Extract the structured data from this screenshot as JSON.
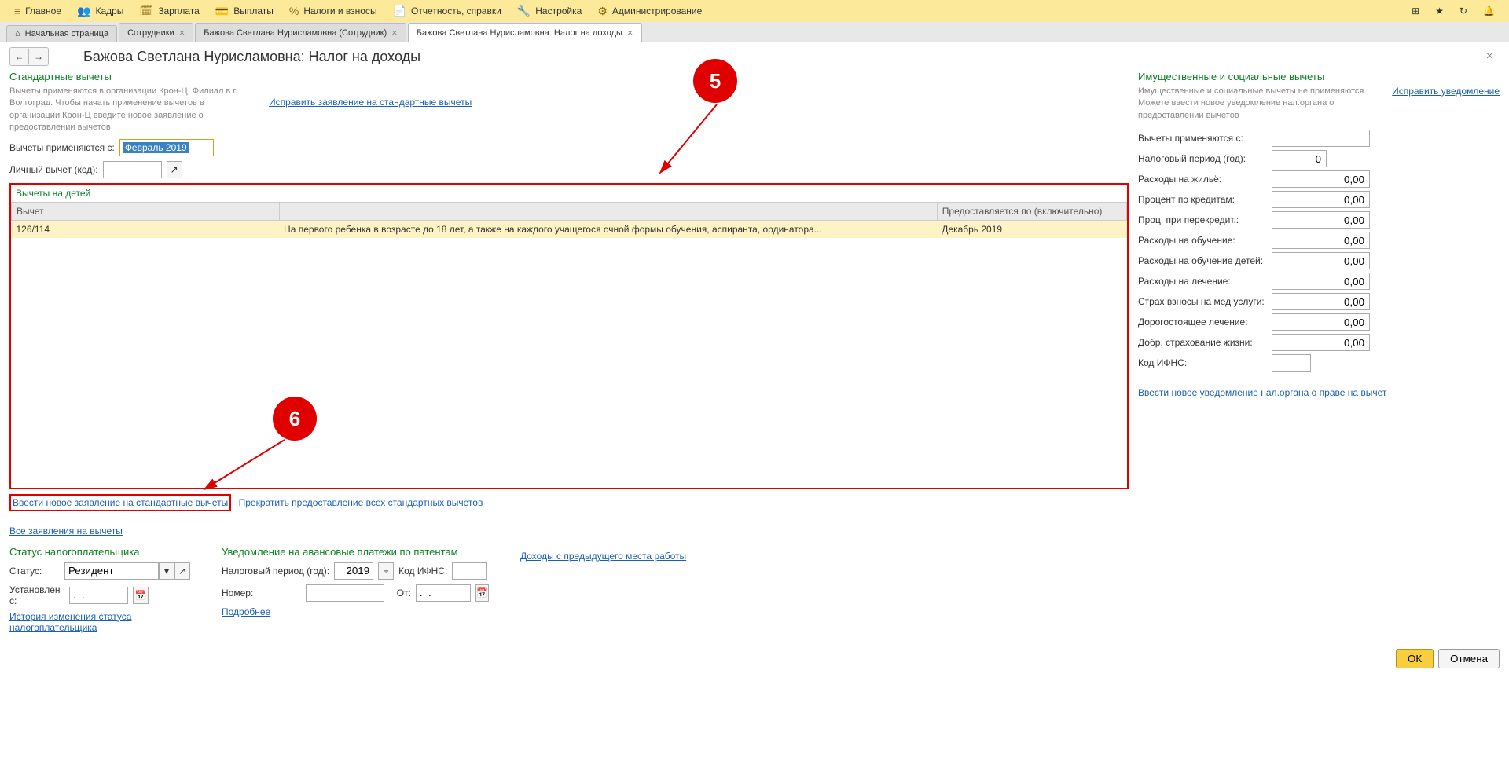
{
  "topbar": {
    "items": [
      {
        "label": "Главное"
      },
      {
        "label": "Кадры"
      },
      {
        "label": "Зарплата"
      },
      {
        "label": "Выплаты"
      },
      {
        "label": "Налоги и взносы"
      },
      {
        "label": "Отчетность, справки"
      },
      {
        "label": "Настройка"
      },
      {
        "label": "Администрирование"
      }
    ]
  },
  "tabs": [
    {
      "label": "Начальная страница",
      "closable": false,
      "home": true
    },
    {
      "label": "Сотрудники",
      "closable": true
    },
    {
      "label": "Бажова Светлана Нурисламовна (Сотрудник)",
      "closable": true
    },
    {
      "label": "Бажова Светлана Нурисламовна: Налог на доходы",
      "closable": true,
      "active": true
    }
  ],
  "pageTitle": "Бажова Светлана Нурисламовна: Налог на доходы",
  "std": {
    "title": "Стандартные вычеты",
    "hint": "Вычеты применяются в организации Крон-Ц, Филиал в г. Волгоград. Чтобы начать применение вычетов в организации Крон-Ц введите новое заявление о предоставлении вычетов",
    "fixLink": "Исправить заявление на стандартные вычеты",
    "appliedFromLabel": "Вычеты применяются с:",
    "appliedFromValue": "Февраль 2019",
    "personalCodeLabel": "Личный вычет (код):",
    "childrenTitle": "Вычеты на детей",
    "table": {
      "col1": "Вычет",
      "col2": "Предоставляется по (включительно)",
      "code": "126/114",
      "desc": "На первого ребенка в возрасте до 18 лет, а также на каждого учащегося очной формы обучения, аспиранта, ординатора...",
      "until": "Декабрь 2019"
    },
    "newStmtLink": "Ввести новое заявление на стандартные вычеты",
    "stopLink": "Прекратить предоставление всех стандартных вычетов",
    "allLink": "Все заявления на вычеты"
  },
  "prop": {
    "title": "Имущественные и социальные вычеты",
    "hint": "Имущественные и социальные вычеты не применяются. Можете ввести новое уведомление нал.органа о предоставлении вычетов",
    "fixLink": "Исправить уведомление",
    "appliedFromLabel": "Вычеты применяются с:",
    "taxPeriodLabel": "Налоговый период (год):",
    "taxPeriodValue": "0",
    "rows": [
      {
        "label": "Расходы на жильё:",
        "value": "0,00"
      },
      {
        "label": "Процент по кредитам:",
        "value": "0,00"
      },
      {
        "label": "Проц. при перекредит.:",
        "value": "0,00"
      },
      {
        "label": "Расходы на обучение:",
        "value": "0,00"
      },
      {
        "label": "Расходы на обучение детей:",
        "value": "0,00"
      },
      {
        "label": "Расходы на лечение:",
        "value": "0,00"
      },
      {
        "label": "Страх взносы на мед услуги:",
        "value": "0,00"
      },
      {
        "label": "Дорогостоящее лечение:",
        "value": "0,00"
      },
      {
        "label": "Добр. страхование жизни:",
        "value": "0,00"
      }
    ],
    "ifnsLabel": "Код ИФНС:",
    "newNoticeLink": "Ввести новое уведомление нал.органа о праве на вычет"
  },
  "status": {
    "title": "Статус налогоплательщика",
    "statusLabel": "Статус:",
    "statusValue": "Резидент",
    "setFromLabel": "Установлен с:",
    "setFromValue": ".  .",
    "historyLink": "История изменения статуса налогоплательщика"
  },
  "patent": {
    "title": "Уведомление на авансовые платежи по патентам",
    "taxPeriodLabel": "Налоговый период (год):",
    "taxPeriodValue": "2019",
    "ifnsLabel": "Код ИФНС:",
    "numberLabel": "Номер:",
    "fromLabel": "От:",
    "fromValue": ".  .",
    "moreLink": "Подробнее"
  },
  "prevIncomeLink": "Доходы с предыдущего места работы",
  "footer": {
    "ok": "ОК",
    "cancel": "Отмена"
  },
  "callouts": {
    "n5": "5",
    "n6": "6"
  }
}
